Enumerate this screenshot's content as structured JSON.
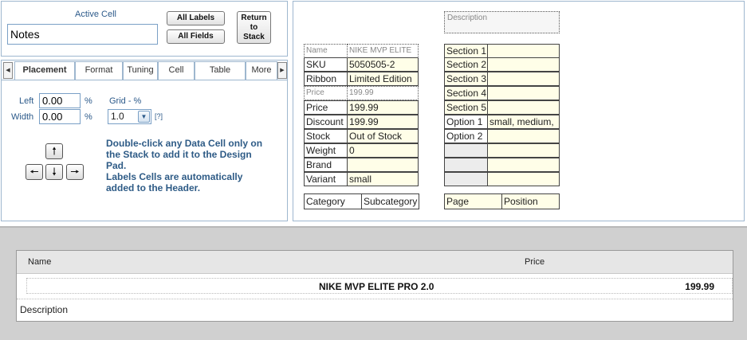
{
  "active_cell": {
    "label": "Active Cell",
    "value": "Notes"
  },
  "buttons": {
    "all_labels": "All Labels",
    "all_fields": "All Fields",
    "return_line1": "Return",
    "return_line2": "to",
    "return_line3": "Stack"
  },
  "tabs": [
    "Placement",
    "Format",
    "Tuning",
    "Cell",
    "Table",
    "More"
  ],
  "placement": {
    "left_label": "Left",
    "left_value": "0.00",
    "width_label": "Width",
    "width_value": "0.00",
    "unit": "%",
    "grid_label": "Grid - %",
    "grid_value": "1.0",
    "help_link": "[?]",
    "help_text_1": "Double-click any Data Cell only on the Stack to add it to the Design Pad.",
    "help_text_2": "Labels Cells are automatically added to the Header."
  },
  "design_pad": {
    "description_placeholder": "Description",
    "fields": [
      {
        "label": "Name",
        "value": "NIKE MVP ELITE"
      },
      {
        "label": "SKU",
        "value": "5050505-2"
      },
      {
        "label": "Ribbon",
        "value": "Limited Edition"
      },
      {
        "label": "Price",
        "value": "199.99"
      },
      {
        "label": "Price",
        "value": "199.99"
      },
      {
        "label": "Discount",
        "value": "199.99"
      },
      {
        "label": "Stock",
        "value": "Out of Stock"
      },
      {
        "label": "Weight",
        "value": "0"
      },
      {
        "label": "Brand",
        "value": ""
      },
      {
        "label": "Variant",
        "value": "small"
      }
    ],
    "sections": [
      {
        "label": "Section 1",
        "value": ""
      },
      {
        "label": "Section 2",
        "value": ""
      },
      {
        "label": "Section 3",
        "value": ""
      },
      {
        "label": "Section 4",
        "value": ""
      },
      {
        "label": "Section 5",
        "value": ""
      },
      {
        "label": "Option 1",
        "value": "small, medium,"
      },
      {
        "label": "Option 2",
        "value": ""
      },
      {
        "label": "",
        "value": ""
      },
      {
        "label": "",
        "value": ""
      },
      {
        "label": "",
        "value": ""
      }
    ],
    "footer_left": [
      "Category",
      "Subcategory"
    ],
    "footer_right": [
      "Page",
      "Position"
    ]
  },
  "preview": {
    "header_name": "Name",
    "header_price": "Price",
    "row_name": "NIKE MVP ELITE PRO 2.0",
    "row_price": "199.99",
    "description_label": "Description"
  }
}
